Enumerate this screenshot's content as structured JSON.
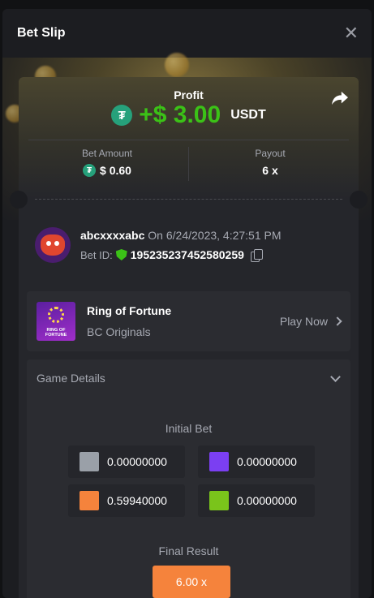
{
  "header": {
    "title": "Bet Slip",
    "close_icon": "close-icon"
  },
  "profit": {
    "label": "Profit",
    "currency_icon": "tether-icon",
    "value": "+$ 3.00",
    "unit": "USDT",
    "share_icon": "share-icon",
    "value_color": "#3bc117"
  },
  "bet_amount": {
    "label": "Bet Amount",
    "value": "$ 0.60"
  },
  "payout": {
    "label": "Payout",
    "value": "6 x"
  },
  "user": {
    "name": "abcxxxxabc",
    "date_text": "On 6/24/2023, 4:27:51 PM",
    "bet_id_label": "Bet ID:",
    "bet_id": "195235237452580259",
    "verified_icon": "shield-check-icon",
    "copy_icon": "copy-icon"
  },
  "game": {
    "name": "Ring of Fortune",
    "provider": "BC Originals",
    "thumb_text": "RING OF FORTUNE",
    "play_label": "Play Now"
  },
  "details": {
    "title": "Game Details",
    "initial_bet_label": "Initial Bet",
    "bets": [
      {
        "color": "#9aa0a8",
        "value": "0.00000000"
      },
      {
        "color": "#7b3ff2",
        "value": "0.00000000"
      },
      {
        "color": "#f5833c",
        "value": "0.59940000"
      },
      {
        "color": "#7ac41b",
        "value": "0.00000000"
      }
    ],
    "final_result_label": "Final Result",
    "final_result": "6.00 x",
    "final_result_color": "#f5833c"
  }
}
